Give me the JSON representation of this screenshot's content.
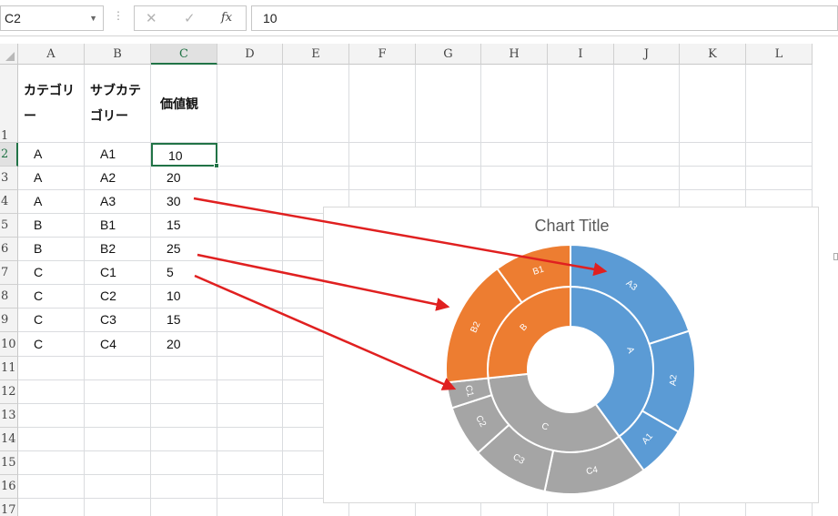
{
  "formula_bar": {
    "name_box": "C2",
    "cancel_symbol": "✕",
    "enter_symbol": "✓",
    "fx_label": "fx",
    "formula_value": "10"
  },
  "columns": [
    "A",
    "B",
    "C",
    "D",
    "E",
    "F",
    "G",
    "H",
    "I",
    "J",
    "K",
    "L"
  ],
  "rows": [
    "1",
    "2",
    "3",
    "4",
    "5",
    "6",
    "7",
    "8",
    "9",
    "10",
    "11",
    "12",
    "13",
    "14",
    "15",
    "16",
    "17"
  ],
  "headers": {
    "category": "カテゴリー",
    "subcategory": "サブカテゴリー",
    "value": "価値観"
  },
  "table": [
    {
      "category": "A",
      "subcategory": "A1",
      "value": "10"
    },
    {
      "category": "A",
      "subcategory": "A2",
      "value": "20"
    },
    {
      "category": "A",
      "subcategory": "A3",
      "value": "30"
    },
    {
      "category": "B",
      "subcategory": "B1",
      "value": "15"
    },
    {
      "category": "B",
      "subcategory": "B2",
      "value": "25"
    },
    {
      "category": "C",
      "subcategory": "C1",
      "value": "5"
    },
    {
      "category": "C",
      "subcategory": "C2",
      "value": "10"
    },
    {
      "category": "C",
      "subcategory": "C3",
      "value": "15"
    },
    {
      "category": "C",
      "subcategory": "C4",
      "value": "20"
    }
  ],
  "chart_data": {
    "type": "sunburst",
    "title": "Chart Title",
    "inner": [
      {
        "label": "A",
        "value": 60,
        "color": "#5b9bd5"
      },
      {
        "label": "B",
        "value": 40,
        "color": "#ed7d31"
      },
      {
        "label": "C",
        "value": 50,
        "color": "#a5a5a5"
      }
    ],
    "outer": [
      {
        "label": "A3",
        "value": 30,
        "parent": "A",
        "color": "#5b9bd5"
      },
      {
        "label": "A2",
        "value": 20,
        "parent": "A",
        "color": "#5b9bd5"
      },
      {
        "label": "A1",
        "value": 10,
        "parent": "A",
        "color": "#5b9bd5"
      },
      {
        "label": "C4",
        "value": 20,
        "parent": "C",
        "color": "#a5a5a5"
      },
      {
        "label": "C3",
        "value": 15,
        "parent": "C",
        "color": "#a5a5a5"
      },
      {
        "label": "C2",
        "value": 10,
        "parent": "C",
        "color": "#a5a5a5"
      },
      {
        "label": "C1",
        "value": 5,
        "parent": "C",
        "color": "#a5a5a5"
      },
      {
        "label": "B2",
        "value": 25,
        "parent": "B",
        "color": "#ed7d31"
      },
      {
        "label": "B1",
        "value": 15,
        "parent": "B",
        "color": "#ed7d31"
      }
    ]
  },
  "annotation_arrows": [
    {
      "from_cell": "C4",
      "to_segment": "A3",
      "color": "#e02020"
    },
    {
      "from_cell": "C6",
      "to_segment": "B2",
      "color": "#e02020"
    },
    {
      "from_cell": "C7",
      "to_segment": "C1",
      "color": "#e02020"
    }
  ]
}
